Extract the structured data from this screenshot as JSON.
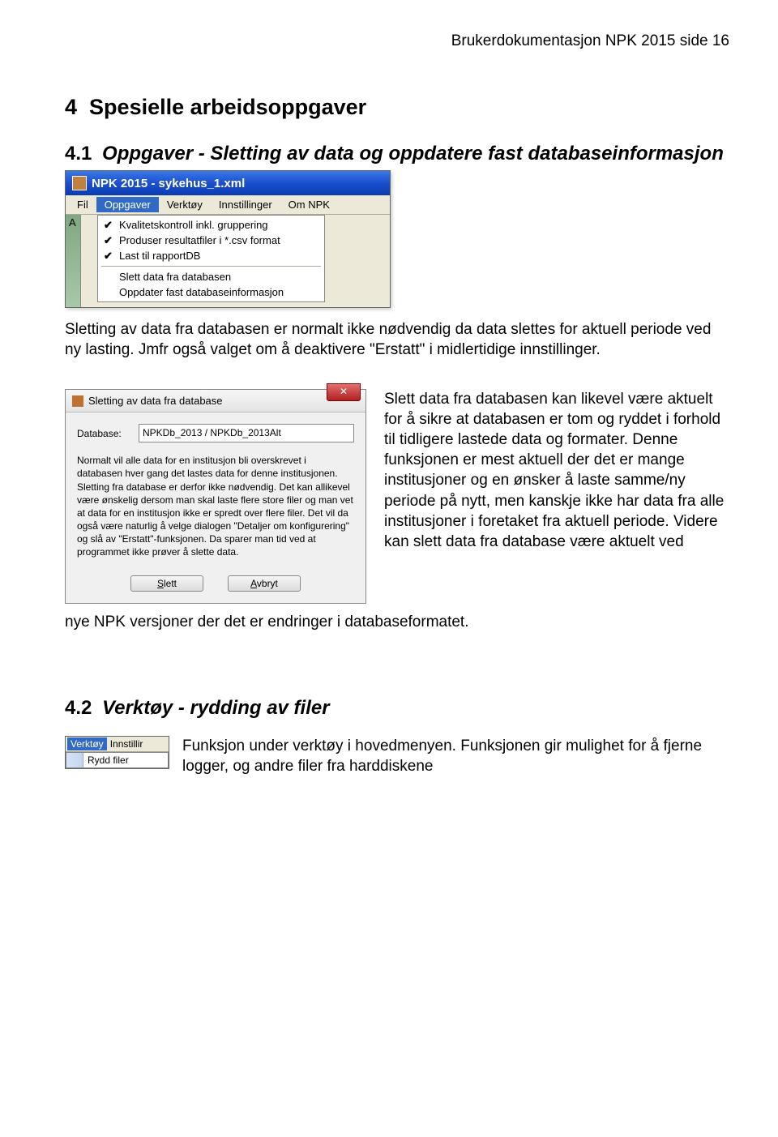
{
  "header": "Brukerdokumentasjon NPK 2015 side 16",
  "section4": {
    "num": "4",
    "title": "Spesielle arbeidsoppgaver"
  },
  "section41": {
    "num": "4.1",
    "title": "Oppgaver - Sletting av data og oppdatere fast databaseinformasjon"
  },
  "screenshot1": {
    "title": "NPK 2015 - sykehus_1.xml",
    "menus": {
      "fil": "Fil",
      "oppgaver": "Oppgaver",
      "verktoy": "Verktøy",
      "innstillinger": "Innstillinger",
      "om": "Om NPK"
    },
    "leftLetter": "A",
    "items": {
      "i1": "Kvalitetskontroll inkl. gruppering",
      "i2": "Produser resultatfiler i *.csv format",
      "i3": "Last til rapportDB",
      "i4": "Slett data fra databasen",
      "i5": "Oppdater fast databaseinformasjon"
    }
  },
  "para1": "Sletting av data fra databasen er normalt ikke nødvendig da data slettes for aktuell periode ved ny lasting. Jmfr også valget om å deaktivere \"Erstatt\" i midlertidige innstillinger.",
  "screenshot2": {
    "title": "Sletting av data fra database",
    "dbLabel": "Database:",
    "dbValue": "NPKDb_2013 / NPKDb_2013Alt",
    "infoText": "Normalt vil alle data for en institusjon bli overskrevet i databasen hver gang det lastes data for denne institusjonen. Sletting fra database er derfor ikke nødvendig. Det kan allikevel være ønskelig dersom man skal laste flere store filer og man vet at data for en institusjon ikke er spredt over flere filer. Det vil da også være naturlig å velge dialogen \"Detaljer om konfigurering\" og slå av \"Erstatt\"-funksjonen. Da sparer man tid ved at programmet ikke prøver å slette data.",
    "btnSlett": "Slett",
    "btnAvbryt": "Avbryt"
  },
  "para2pre": "Slett data fra databasen kan likevel være aktuelt  for å sikre at databasen er tom og ryddet i forhold til tidligere lastede data og formater.  Denne funksjonen er mest aktuell der det er mange institusjoner og en ønsker å laste samme/ny periode på nytt, men kanskje ikke har data fra alle institusjoner i foretaket fra aktuell periode.  Videre kan slett data fra database være aktuelt ved",
  "para2post": "nye NPK versjoner der det er endringer i databaseformatet.",
  "section42": {
    "num": "4.2",
    "title": "Verktøy - rydding av filer"
  },
  "screenshot3": {
    "menus": {
      "verktoy": "Verktøy",
      "innstillir": "Innstillir"
    },
    "item": "Rydd filer"
  },
  "para3": "Funksjon under verktøy i hovedmenyen. Funksjonen gir mulighet for å fjerne logger, og andre filer fra harddiskene"
}
